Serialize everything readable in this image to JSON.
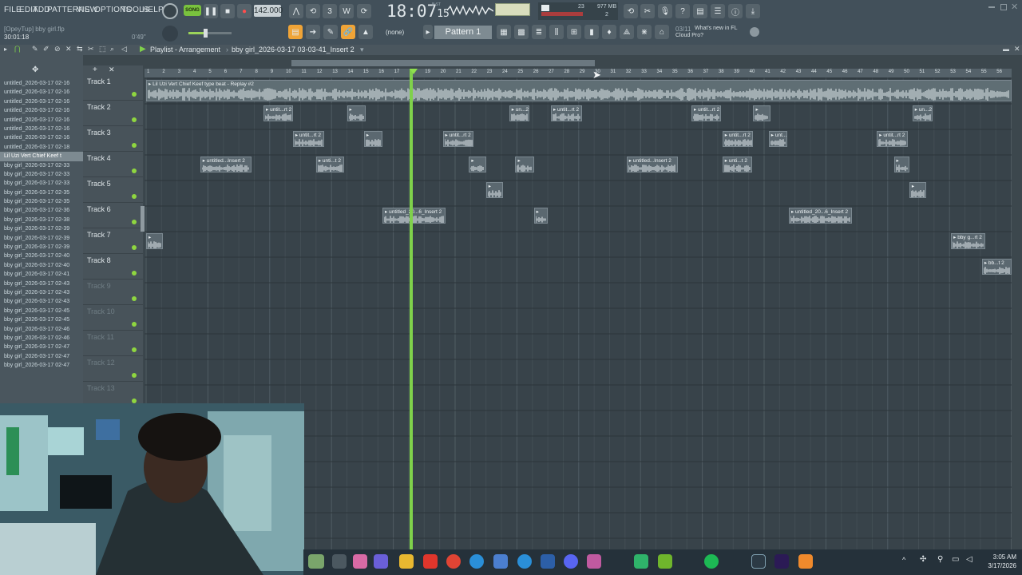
{
  "app": {
    "project_label": "[OpeyTup] bby girl.flp",
    "song_position": "30:01:18",
    "duration": "0'49\""
  },
  "menu": [
    "FILE",
    "EDIT",
    "ADD",
    "PATTERNS",
    "VIEW",
    "OPTIONS",
    "TOOLS",
    "HELP"
  ],
  "transport": {
    "mode": "SONG",
    "tempo": "142.000",
    "time_main": "18:07",
    "time_ticks": "15",
    "time_suffix": "B:ST",
    "cpu": "23",
    "memory": "977 MB",
    "voices": "2",
    "snap": "(none)",
    "pattern": "Pattern 1"
  },
  "news": {
    "date": "03/11",
    "title": "What's new in FL",
    "subtitle": "Cloud Pro?"
  },
  "playlist": {
    "title": "Playlist - Arrangement",
    "breadcrumb": "bby girl_2026-03-17 03-03-41_Insert 2"
  },
  "browser_files": [
    "untitled_2026-03-17 02-16",
    "untitled_2026-03-17 02-16",
    "untitled_2026-03-17 02-16",
    "untitled_2026-03-17 02-16",
    "untitled_2026-03-17 02-16",
    "untitled_2026-03-17 02-16",
    "untitled_2026-03-17 02-16",
    "untitled_2026-03-17 02-18",
    "Lil Uzi Vert Chief Keef t",
    "bby girl_2026-03-17 02-33",
    "bby girl_2026-03-17 02-33",
    "bby girl_2026-03-17 02-33",
    "bby girl_2026-03-17 02-35",
    "bby girl_2026-03-17 02-35",
    "bby girl_2026-03-17 02-36",
    "bby girl_2026-03-17 02-38",
    "bby girl_2026-03-17 02-39",
    "bby girl_2026-03-17 02-39",
    "bby girl_2026-03-17 02-39",
    "bby girl_2026-03-17 02-40",
    "bby girl_2026-03-17 02-40",
    "bby girl_2026-03-17 02-41",
    "bby girl_2026-03-17 02-43",
    "bby girl_2026-03-17 02-43",
    "bby girl_2026-03-17 02-43",
    "bby girl_2026-03-17 02-45",
    "bby girl_2026-03-17 02-45",
    "bby girl_2026-03-17 02-46",
    "bby girl_2026-03-17 02-46",
    "bby girl_2026-03-17 02-47",
    "bby girl_2026-03-17 02-47",
    "bby girl_2026-03-17 02-47"
  ],
  "tracks": [
    {
      "label": "Track 1",
      "active": true
    },
    {
      "label": "Track 2",
      "active": true
    },
    {
      "label": "Track 3",
      "active": true
    },
    {
      "label": "Track 4",
      "active": true
    },
    {
      "label": "Track 5",
      "active": true
    },
    {
      "label": "Track 6",
      "active": true
    },
    {
      "label": "Track 7",
      "active": true
    },
    {
      "label": "Track 8",
      "active": true
    },
    {
      "label": "Track 9",
      "active": false
    },
    {
      "label": "Track 10",
      "active": false
    },
    {
      "label": "Track 11",
      "active": false
    },
    {
      "label": "Track 12",
      "active": false
    },
    {
      "label": "Track 13",
      "active": false
    }
  ],
  "ruler_bars": [
    "1",
    "2",
    "3",
    "4",
    "5",
    "6",
    "7",
    "8",
    "9",
    "10",
    "11",
    "12",
    "13",
    "14",
    "15",
    "16",
    "17",
    "18",
    "19",
    "20",
    "21",
    "22",
    "23",
    "24",
    "25",
    "26",
    "27",
    "28",
    "29",
    "30",
    "31",
    "32",
    "33",
    "34",
    "35",
    "36",
    "37",
    "38",
    "39",
    "40",
    "41",
    "42",
    "43",
    "44",
    "45",
    "46",
    "47",
    "48",
    "49",
    "50",
    "51",
    "52",
    "53",
    "54",
    "55",
    "56"
  ],
  "clips": [
    {
      "track": 1,
      "start": 1,
      "len": 56,
      "label": "Lil Uzi Vert  Chief Keef type beat - Replay #2"
    },
    {
      "track": 2,
      "start": 8.6,
      "len": 1.9,
      "label": "untit...rt 2"
    },
    {
      "track": 2,
      "start": 14,
      "len": 1.2,
      "label": ""
    },
    {
      "track": 2,
      "start": 24.5,
      "len": 1.3,
      "label": "un...2"
    },
    {
      "track": 2,
      "start": 27.2,
      "len": 2.0,
      "label": "untit...rt 2"
    },
    {
      "track": 2,
      "start": 36.3,
      "len": 1.9,
      "label": "untit...rt 2"
    },
    {
      "track": 2,
      "start": 40.3,
      "len": 1.1,
      "label": ""
    },
    {
      "track": 2,
      "start": 50.6,
      "len": 1.3,
      "label": "un...2"
    },
    {
      "track": 3,
      "start": 10.5,
      "len": 2.0,
      "label": "untit...rt 2"
    },
    {
      "track": 3,
      "start": 15.1,
      "len": 1.2,
      "label": ""
    },
    {
      "track": 3,
      "start": 20.2,
      "len": 2.0,
      "label": "untit...rt 2"
    },
    {
      "track": 3,
      "start": 38.3,
      "len": 2.0,
      "label": "untit...rt 2"
    },
    {
      "track": 3,
      "start": 41.3,
      "len": 1.2,
      "label": "unt..."
    },
    {
      "track": 3,
      "start": 48.3,
      "len": 2.0,
      "label": "untit...rt 2"
    },
    {
      "track": 4,
      "start": 4.5,
      "len": 3.3,
      "label": "untitled...Insert 2"
    },
    {
      "track": 4,
      "start": 12.0,
      "len": 1.8,
      "label": "unti...t 2"
    },
    {
      "track": 4,
      "start": 21.9,
      "len": 1.1,
      "label": ""
    },
    {
      "track": 4,
      "start": 24.9,
      "len": 1.2,
      "label": ""
    },
    {
      "track": 4,
      "start": 32.1,
      "len": 3.3,
      "label": "untitled...Insert 2"
    },
    {
      "track": 4,
      "start": 38.3,
      "len": 1.9,
      "label": "unti...t 2"
    },
    {
      "track": 4,
      "start": 49.4,
      "len": 1.0,
      "label": ""
    },
    {
      "track": 5,
      "start": 23.0,
      "len": 1.1,
      "label": ""
    },
    {
      "track": 5,
      "start": 50.4,
      "len": 1.1,
      "label": ""
    },
    {
      "track": 6,
      "start": 16.3,
      "len": 4.1,
      "label": "untitled_20...6_Insert 2"
    },
    {
      "track": 6,
      "start": 26.1,
      "len": 0.9,
      "label": ""
    },
    {
      "track": 6,
      "start": 42.6,
      "len": 4.1,
      "label": "untitled_20...6_Insert 2"
    },
    {
      "track": 7,
      "start": 1.0,
      "len": 1.1,
      "label": ""
    },
    {
      "track": 7,
      "start": 53.1,
      "len": 2.2,
      "label": "bby g...rt 2"
    },
    {
      "track": 8,
      "start": 55.1,
      "len": 1.9,
      "label": "bb...t 2"
    }
  ],
  "playhead_bar": 18.1,
  "taskbar": {
    "time": "3:05 AM",
    "date": "3/17/2026"
  }
}
